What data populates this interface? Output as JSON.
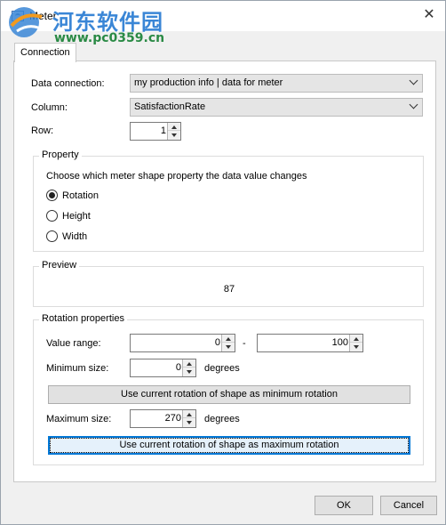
{
  "window": {
    "title": "Meter",
    "close_glyph": "✕"
  },
  "watermark": {
    "line1": "河东软件园",
    "line2": "www.pc0359.cn"
  },
  "tab": {
    "label": "Connection"
  },
  "connection": {
    "data_connection_label": "Data connection:",
    "data_connection_value": "my production info | data for meter",
    "column_label": "Column:",
    "column_value": "SatisfactionRate",
    "row_label": "Row:",
    "row_value": "1"
  },
  "property": {
    "title": "Property",
    "description": "Choose which meter shape property the data value changes",
    "options": [
      {
        "label": "Rotation",
        "selected": true
      },
      {
        "label": "Height",
        "selected": false
      },
      {
        "label": "Width",
        "selected": false
      }
    ]
  },
  "preview": {
    "title": "Preview",
    "value": "87"
  },
  "rotation": {
    "title": "Rotation properties",
    "value_range_label": "Value range:",
    "range_min": "0",
    "range_sep": "-",
    "range_max": "100",
    "min_size_label": "Minimum size:",
    "min_size_value": "0",
    "min_unit": "degrees",
    "min_button": "Use current rotation of shape as minimum rotation",
    "max_size_label": "Maximum size:",
    "max_size_value": "270",
    "max_unit": "degrees",
    "max_button": "Use current rotation of shape as maximum rotation"
  },
  "footer": {
    "ok_label": "OK",
    "cancel_label": "Cancel"
  },
  "colors": {
    "focus_border": "#0078d7",
    "watermark_blue": "#3a86d6",
    "watermark_green": "#2a8a45"
  }
}
